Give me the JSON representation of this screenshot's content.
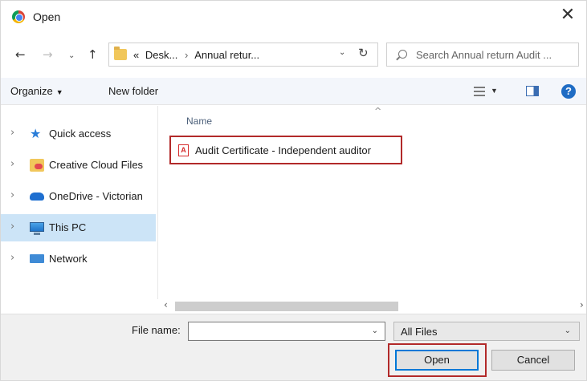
{
  "window": {
    "title": "Open",
    "close_glyph": "✕"
  },
  "nav": {
    "back": "←",
    "forward": "→",
    "recent": "⌄",
    "up": "↑"
  },
  "address": {
    "prefix": "«",
    "crumbs": [
      "Desk...",
      "Annual retur..."
    ],
    "separator": "›",
    "dropdown": "⌄",
    "refresh": "↻"
  },
  "search": {
    "placeholder": "Search Annual return Audit ..."
  },
  "toolbar": {
    "organize_label": "Organize",
    "organize_caret": "▼",
    "new_folder_label": "New folder",
    "view_caret": "▼",
    "help_glyph": "?"
  },
  "sidebar": {
    "items": [
      {
        "label": "Quick access",
        "icon": "star-icon",
        "chevron": "›"
      },
      {
        "label": "Creative Cloud Files",
        "icon": "creative-cloud-folder-icon",
        "chevron": "›"
      },
      {
        "label": "OneDrive - Victorian",
        "icon": "onedrive-cloud-icon",
        "chevron": "›"
      },
      {
        "label": "This PC",
        "icon": "computer-icon",
        "chevron": "›",
        "selected": true
      },
      {
        "label": "Network",
        "icon": "network-icon",
        "chevron": "›"
      }
    ]
  },
  "file_list": {
    "column_header": "Name",
    "sort_indicator": "^",
    "files": [
      {
        "name": "Audit Certificate - Independent auditor",
        "icon": "pdf-icon"
      }
    ]
  },
  "scrollbar": {
    "left_arrow": "‹",
    "right_arrow": "›"
  },
  "footer": {
    "file_name_label": "File name:",
    "file_name_value": "",
    "file_name_dropdown": "⌄",
    "file_type": "All Files",
    "file_type_dropdown": "⌄",
    "open_label": "Open",
    "cancel_label": "Cancel"
  },
  "colors": {
    "highlight_box": "#b22a2a",
    "selection": "#cce4f7",
    "accent": "#0078d7"
  }
}
